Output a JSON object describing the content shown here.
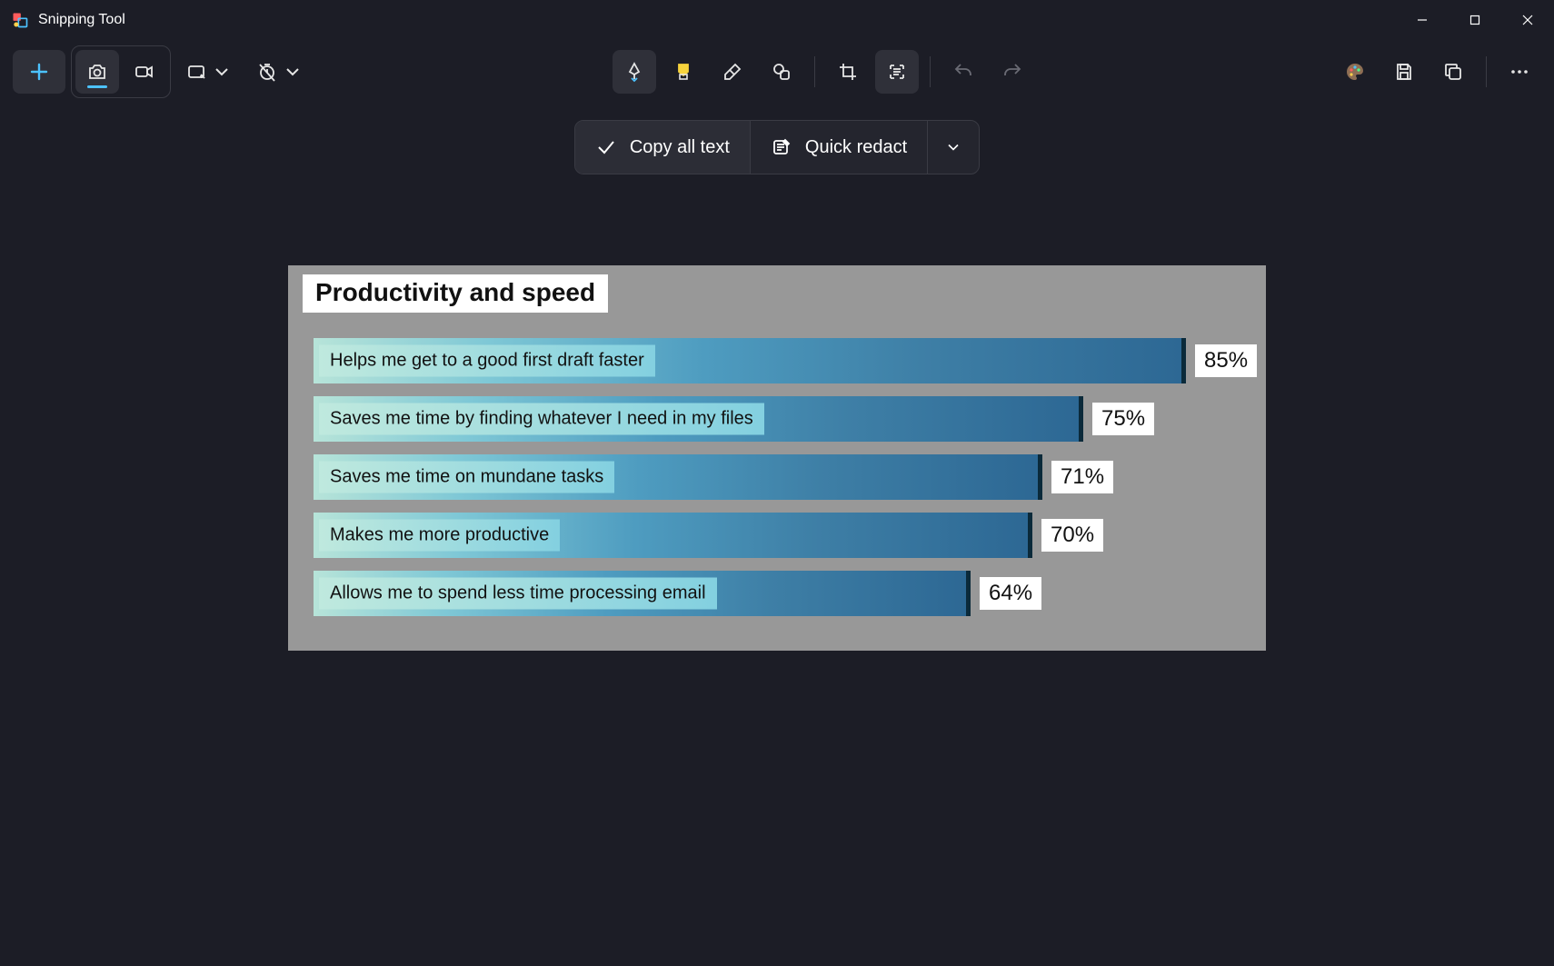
{
  "app": {
    "title": "Snipping Tool"
  },
  "text_actions": {
    "copy_label": "Copy all text",
    "redact_label": "Quick redact"
  },
  "chart_data": {
    "type": "bar",
    "title": "Productivity and speed",
    "xlabel": "",
    "ylabel": "",
    "ylim": [
      0,
      100
    ],
    "orientation": "horizontal",
    "categories": [
      "Helps me get to a good first draft faster",
      "Saves me time by finding whatever I need in my files",
      "Saves me time on mundane tasks",
      "Makes me more productive",
      "Allows me to spend less time processing email"
    ],
    "values": [
      85,
      75,
      71,
      70,
      64
    ],
    "value_labels": [
      "85%",
      "75%",
      "71%",
      "70%",
      "64%"
    ]
  }
}
